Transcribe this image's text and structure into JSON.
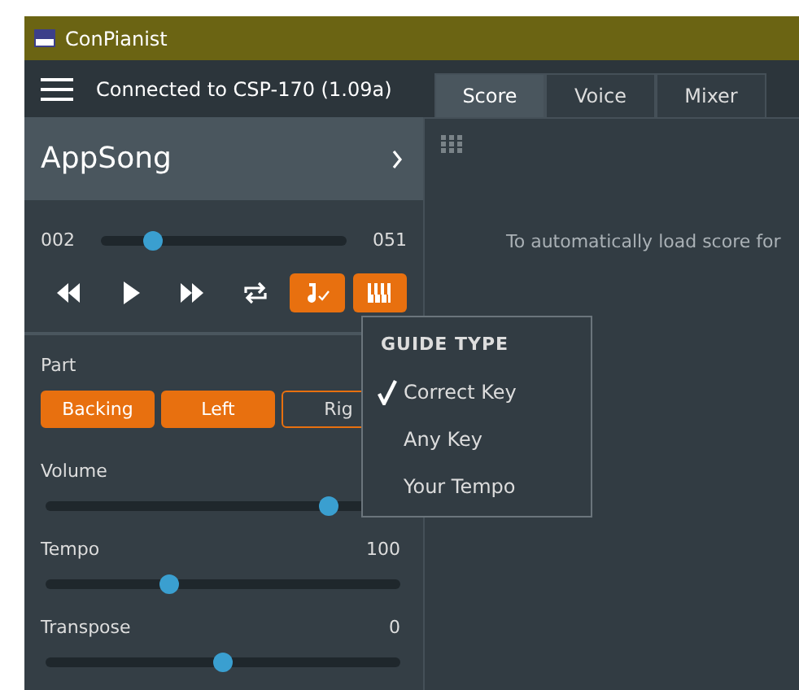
{
  "window": {
    "title": "ConPianist"
  },
  "header": {
    "status": "Connected to CSP-170 (1.09a)"
  },
  "song": {
    "name": "AppSong"
  },
  "position": {
    "start": "002",
    "end": "051",
    "level": 0.21
  },
  "transport": [
    {
      "kind": "rewind",
      "on": false
    },
    {
      "kind": "play",
      "on": false
    },
    {
      "kind": "forward",
      "on": false
    },
    {
      "kind": "repeat",
      "on": false
    },
    {
      "kind": "guide",
      "on": true
    },
    {
      "kind": "piano",
      "on": true
    }
  ],
  "part": {
    "label": "Part",
    "buttons": [
      {
        "label": "Backing",
        "selected": true
      },
      {
        "label": "Left",
        "selected": true
      },
      {
        "label": "Rig",
        "selected": false
      }
    ]
  },
  "sliders": [
    {
      "label": "Volume",
      "level": 0.8
    },
    {
      "label": "Tempo",
      "value": "100",
      "level": 0.35
    },
    {
      "label": "Transpose",
      "value": "0",
      "level": 0.5
    }
  ],
  "tabs": [
    {
      "label": "Score",
      "selected": true
    },
    {
      "label": "Voice",
      "selected": false
    },
    {
      "label": "Mixer",
      "selected": false
    }
  ],
  "score": {
    "message": "To automatically load score for"
  },
  "guide_menu": {
    "title": "GUIDE TYPE",
    "items": [
      {
        "label": "Correct Key",
        "checked": true
      },
      {
        "label": "Any Key",
        "checked": false
      },
      {
        "label": "Your Tempo",
        "checked": false
      }
    ]
  }
}
